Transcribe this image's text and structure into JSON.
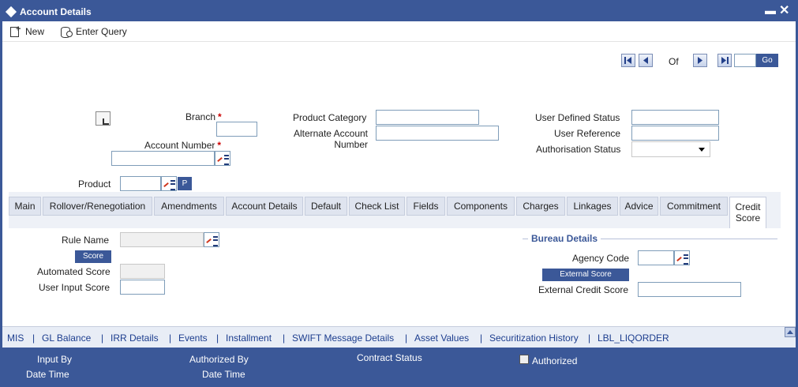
{
  "window": {
    "title": "Account Details"
  },
  "toolbar": {
    "new_label": "New",
    "enter_query_label": "Enter Query"
  },
  "pager": {
    "of_label": "Of",
    "go_label": "Go",
    "page_value": ""
  },
  "form": {
    "branch_label": "Branch",
    "account_number_label": "Account Number",
    "product_label": "Product",
    "p_button_label": "P",
    "product_category_label": "Product Category",
    "alternate_account_label_line1": "Alternate Account",
    "alternate_account_label_line2": "Number",
    "user_defined_status_label": "User Defined Status",
    "user_reference_label": "User Reference",
    "authorisation_status_label": "Authorisation Status",
    "required_marker": "*"
  },
  "tabs": [
    {
      "label": "Main"
    },
    {
      "label": "Rollover/Renegotiation"
    },
    {
      "label": "Amendments"
    },
    {
      "label": "Account Details"
    },
    {
      "label": "Default"
    },
    {
      "label": "Check List"
    },
    {
      "label": "Fields"
    },
    {
      "label": "Components"
    },
    {
      "label": "Charges"
    },
    {
      "label": "Linkages"
    },
    {
      "label": "Advice"
    },
    {
      "label": "Commitment"
    },
    {
      "label_line1": "Credit",
      "label_line2": "Score",
      "active": true
    }
  ],
  "credit_score": {
    "rule_name_label": "Rule Name",
    "score_button": "Score",
    "automated_score_label": "Automated Score",
    "user_input_score_label": "User Input Score",
    "bureau_title": "Bureau Details",
    "agency_code_label": "Agency Code",
    "external_score_button": "External Score",
    "external_credit_score_label": "External Credit Score"
  },
  "links": [
    "MIS",
    "GL Balance",
    "IRR Details",
    "Events",
    "Installment",
    "SWIFT Message Details",
    "Asset Values",
    "Securitization History",
    "LBL_LIQORDER"
  ],
  "link_separator": "|",
  "footer": {
    "input_by": "Input By",
    "date_time_1": "Date Time",
    "authorized_by": "Authorized By",
    "date_time_2": "Date Time",
    "contract_status": "Contract Status",
    "authorized": "Authorized"
  },
  "colors": {
    "brand": "#3b5898",
    "link": "#1c3d8e",
    "required": "#cc0000"
  }
}
